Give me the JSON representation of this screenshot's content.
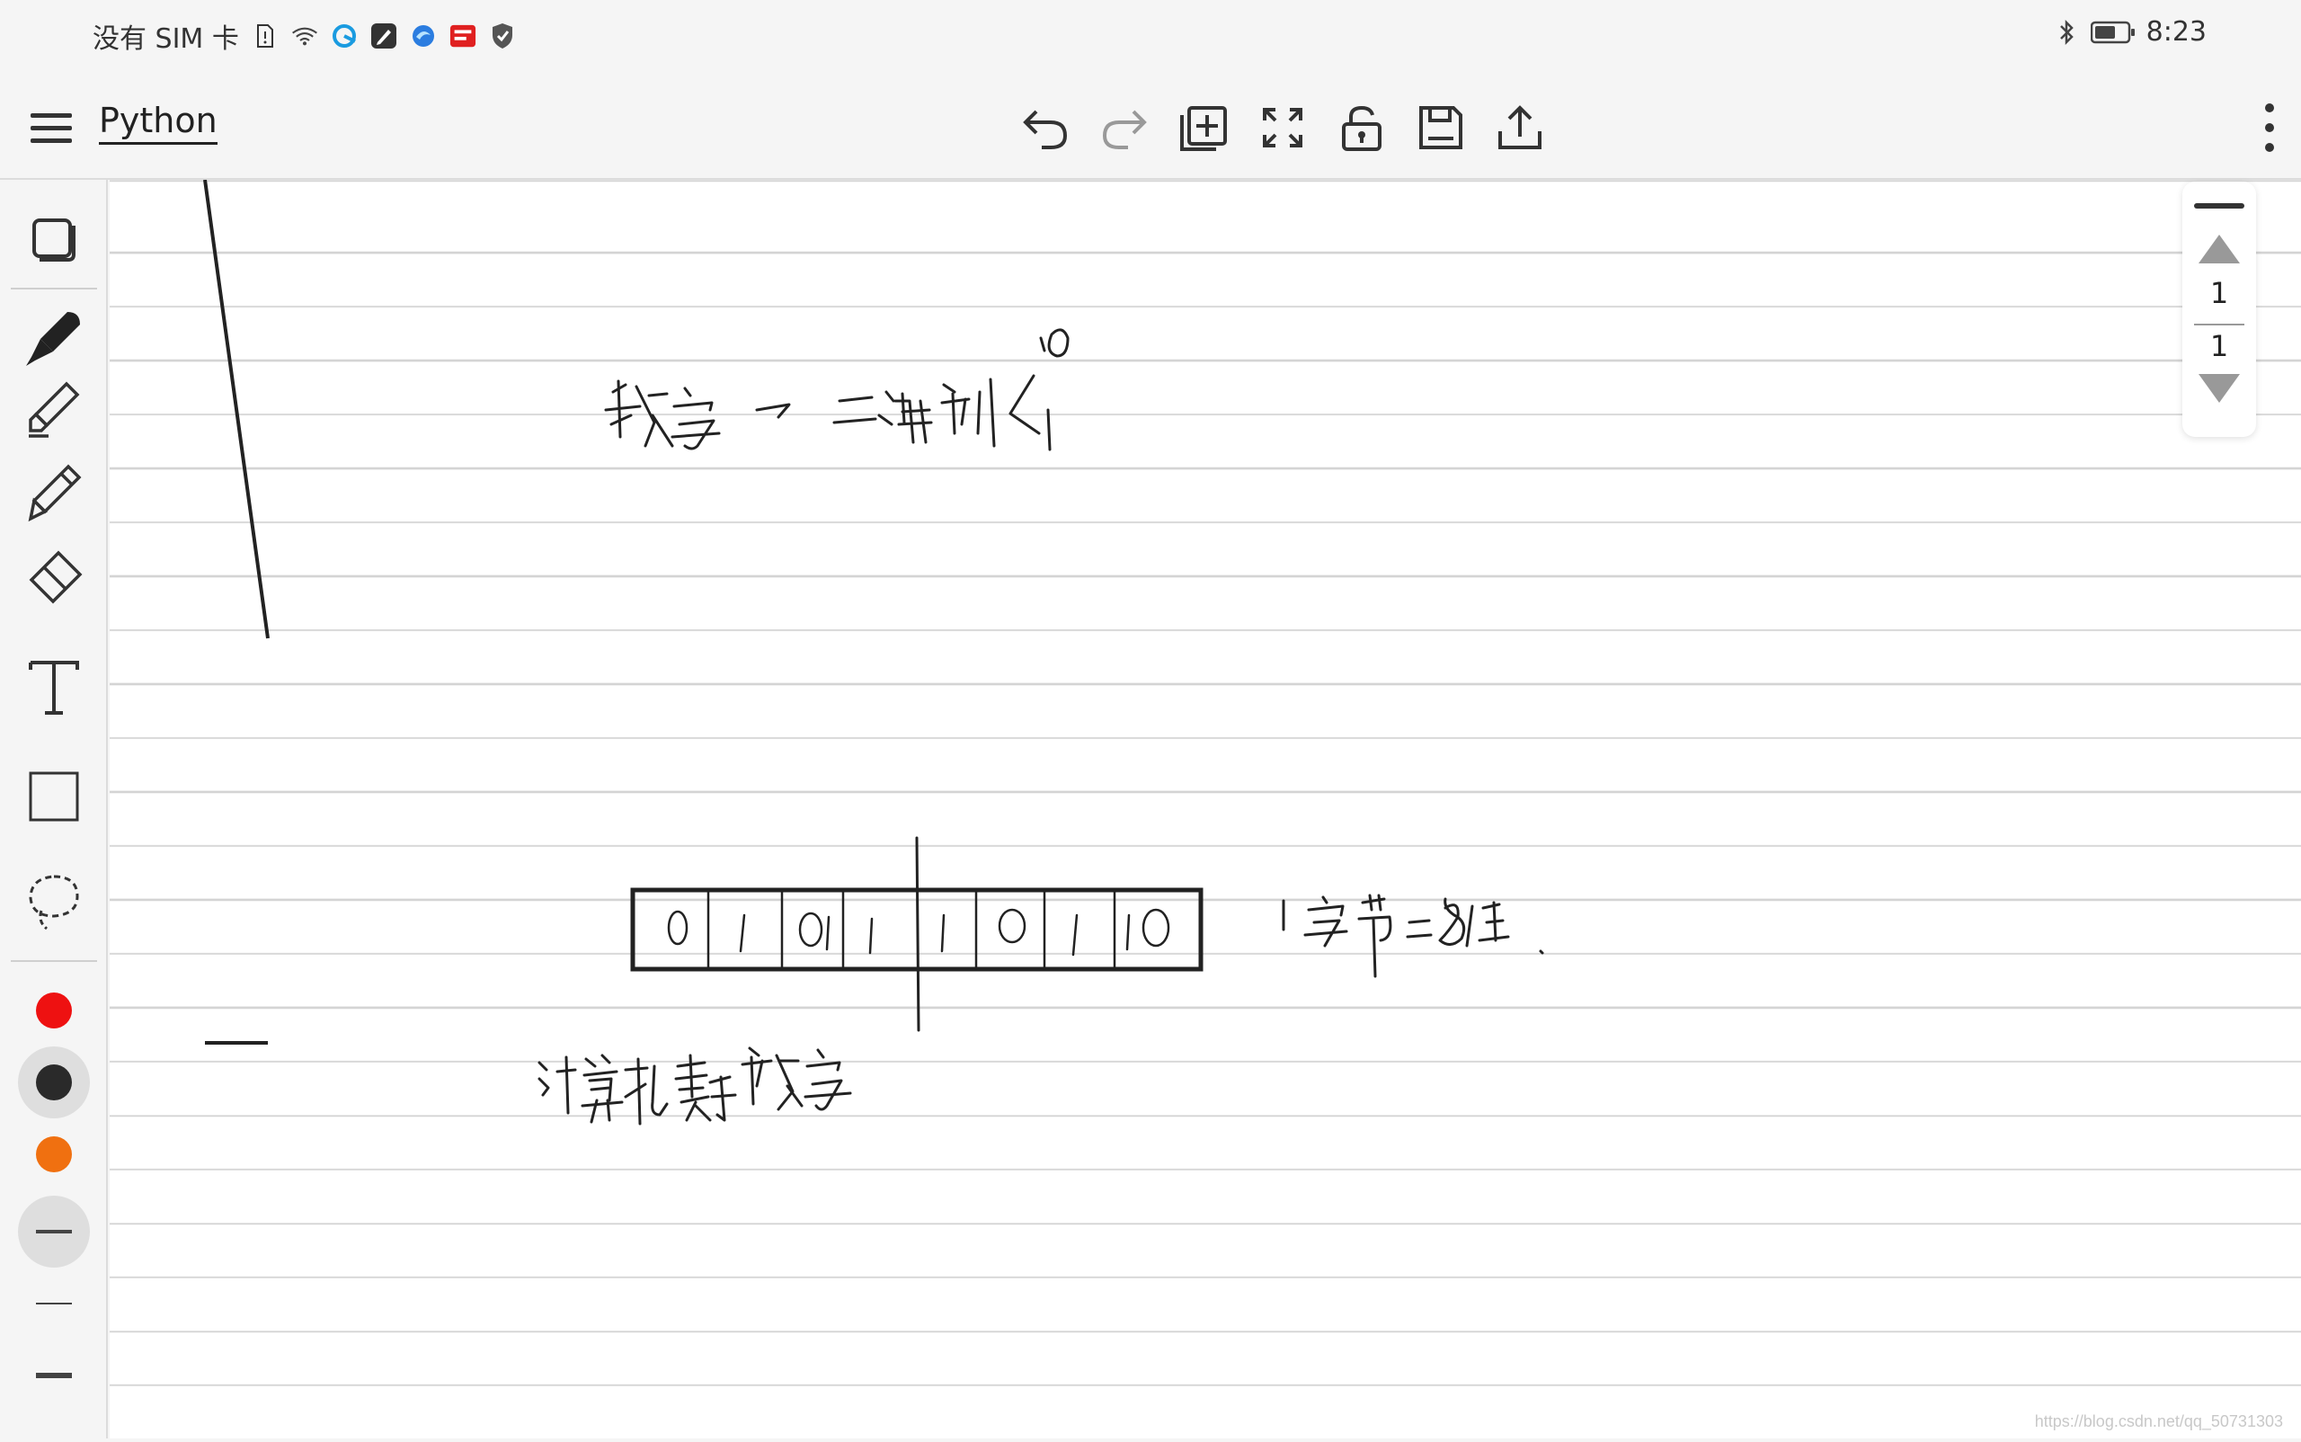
{
  "status_bar": {
    "carrier": "没有 SIM 卡",
    "time": "8:23"
  },
  "toolbar": {
    "title": "Python"
  },
  "pager": {
    "current_page": "1",
    "total_pages": "1"
  },
  "watermark": "https://blog.csdn.net/qq_50731303",
  "colors": {
    "red": "#ee1111",
    "black": "#2a2a2a",
    "orange": "#f07010",
    "selected": "#dedede"
  }
}
